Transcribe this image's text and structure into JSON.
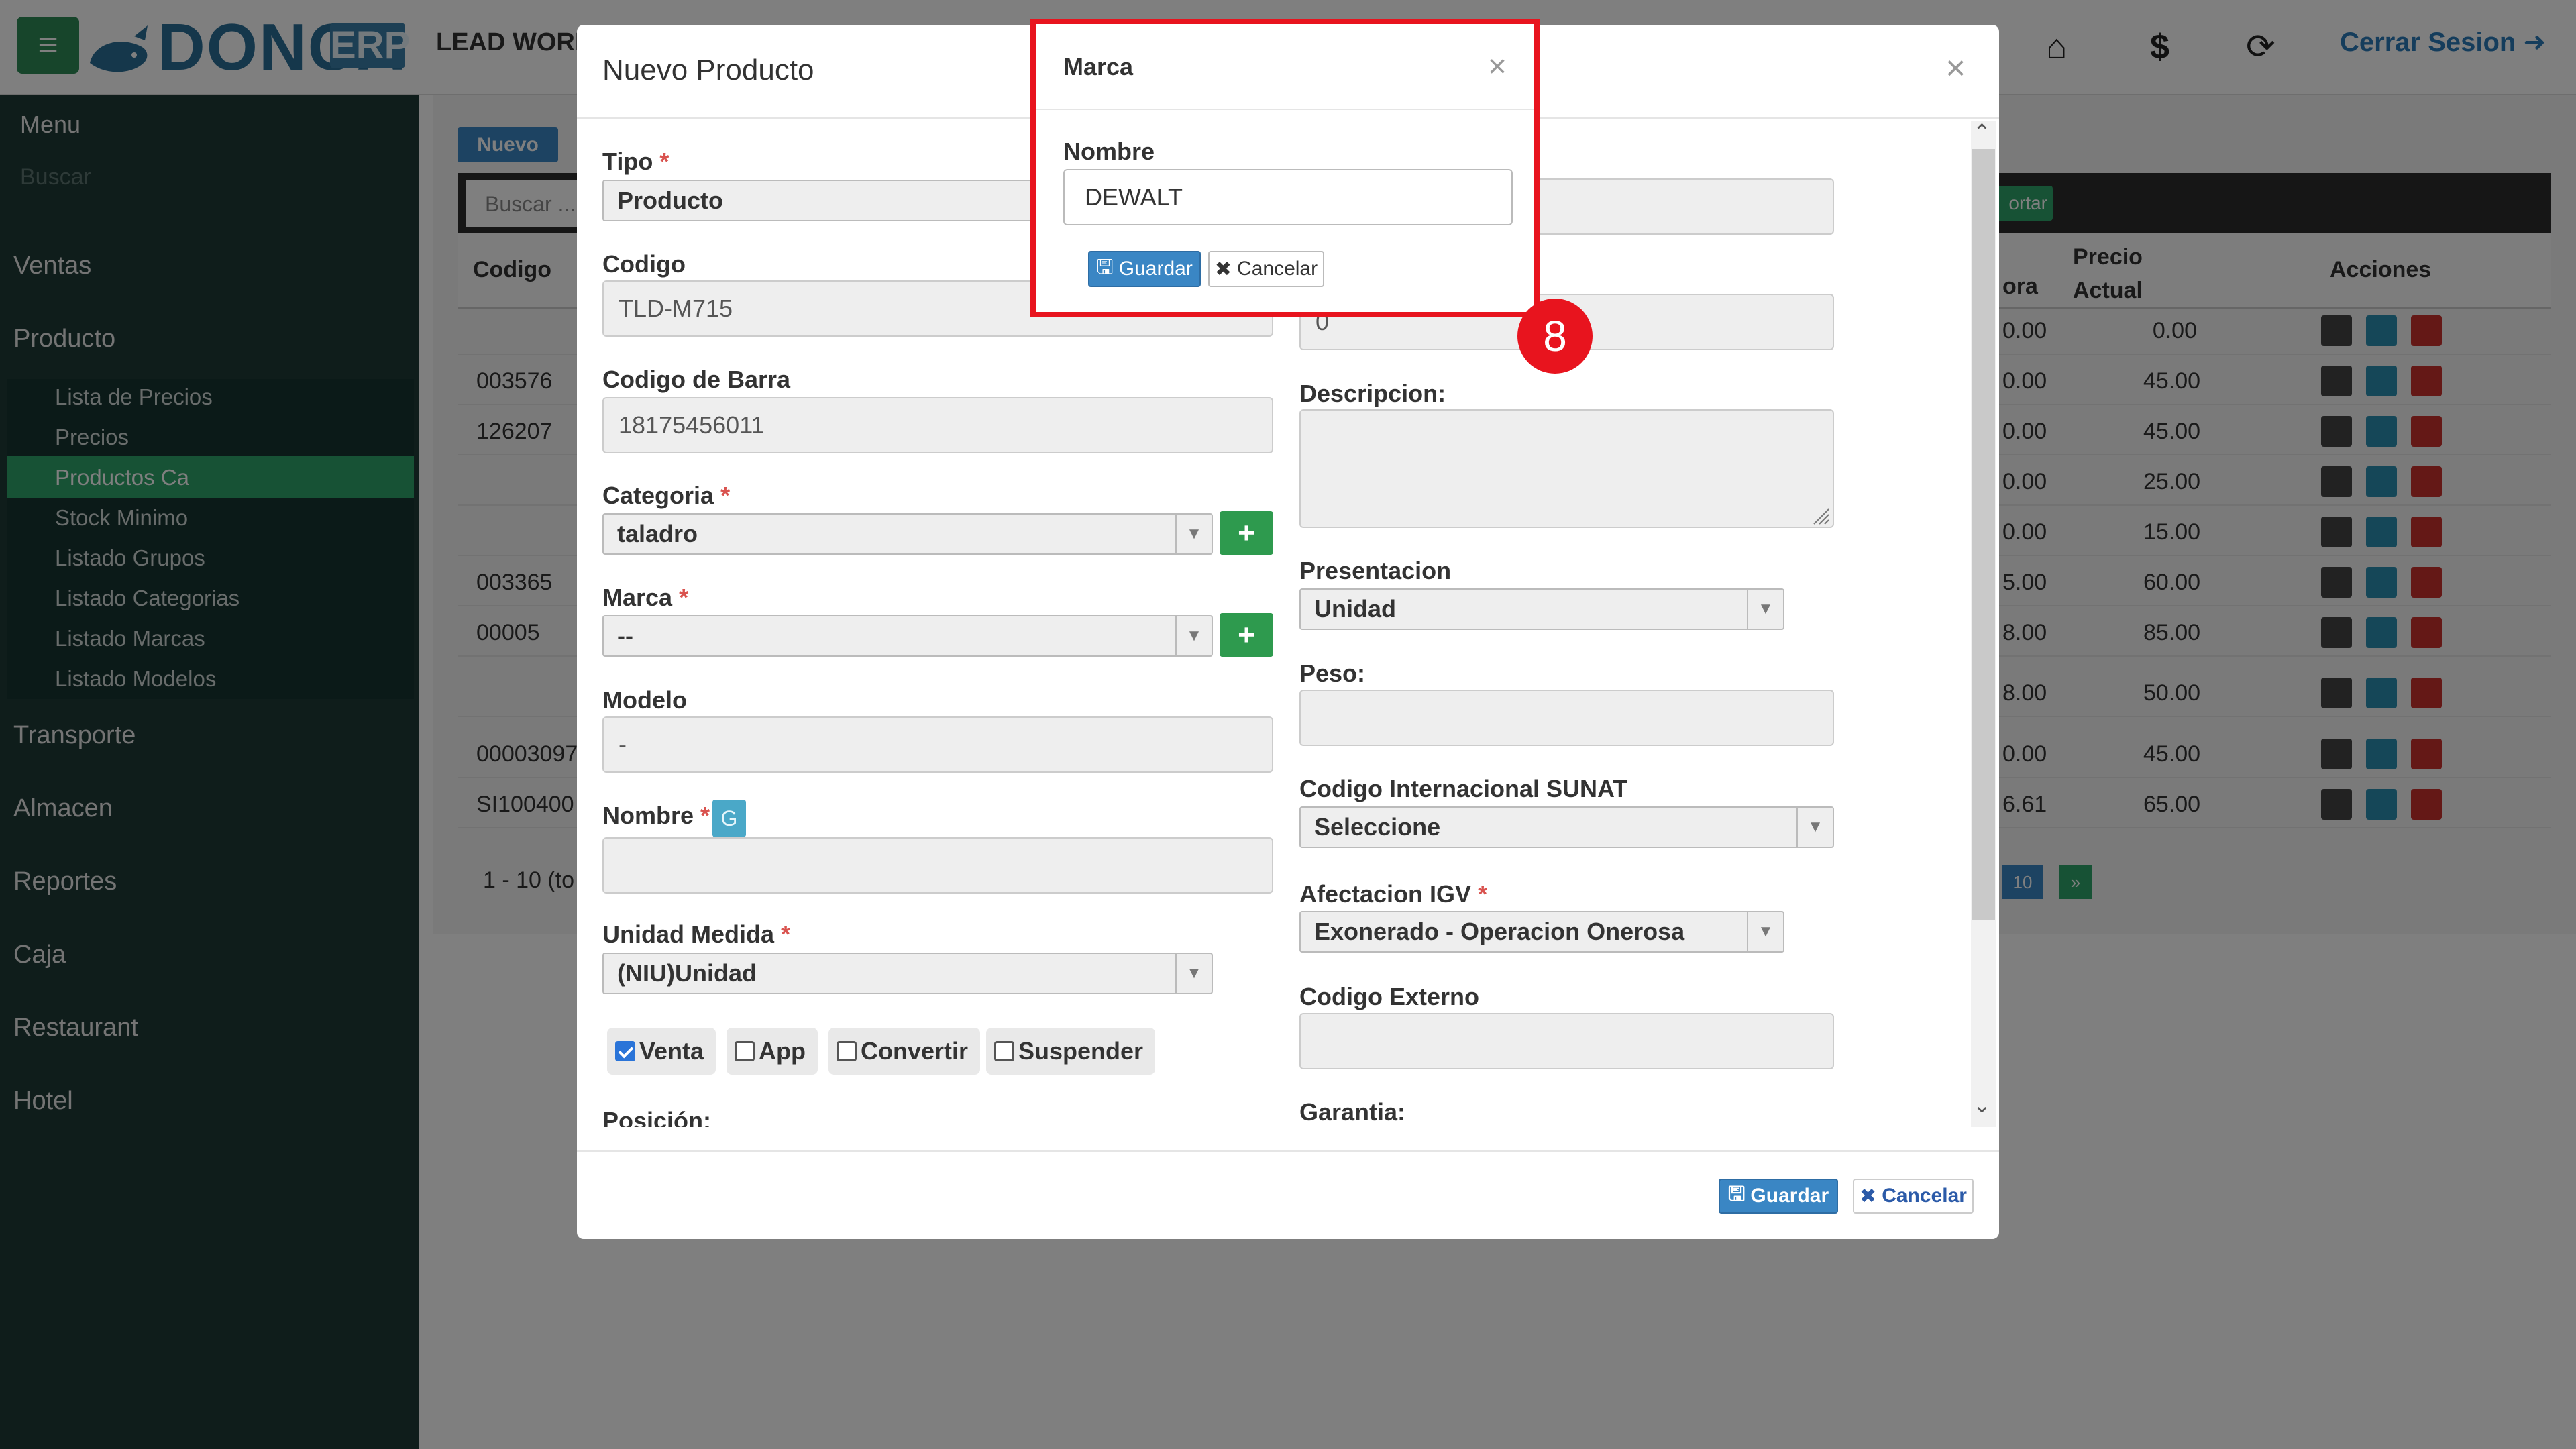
{
  "app": {
    "logo": "DONCA",
    "logo_suffix": "ERP",
    "company": "LEAD WORK",
    "logout": "Cerrar Sesion",
    "icons": [
      "home-icon",
      "dollar-icon",
      "refresh-lock-icon",
      "logout-icon"
    ]
  },
  "sidebar": {
    "menu_title": "Menu",
    "search_placeholder": "Buscar",
    "items": [
      "Ventas",
      "Producto",
      "Transporte",
      "Almacen",
      "Reportes",
      "Caja",
      "Restaurant",
      "Hotel"
    ],
    "product_subitems": [
      "Lista de Precios",
      "Precios",
      "Productos Ca",
      "Stock Minimo",
      "Listado Grupos",
      "Listado Categorias",
      "Listado Marcas",
      "Listado Modelos"
    ],
    "active_subitem": "Productos Ca"
  },
  "background_page": {
    "new_button": "Nuevo",
    "search_placeholder": "Buscar ...",
    "export_label": "ortar",
    "columns": [
      "Codigo",
      "ora",
      "Precio Actual",
      "Acciones"
    ],
    "rows": [
      {
        "code": "",
        "prev": "0.00",
        "price": "0.00"
      },
      {
        "code": "003576",
        "prev": "0.00",
        "price": "45.00"
      },
      {
        "code": "126207",
        "prev": "0.00",
        "price": "45.00"
      },
      {
        "code": "",
        "prev": "0.00",
        "price": "25.00"
      },
      {
        "code": "",
        "prev": "0.00",
        "price": "15.00"
      },
      {
        "code": "003365",
        "prev": "5.00",
        "price": "60.00"
      },
      {
        "code": "00005",
        "prev": "8.00",
        "price": "85.00"
      },
      {
        "code": "",
        "prev": "8.00",
        "price": "50.00"
      },
      {
        "code": "00003097",
        "prev": "0.00",
        "price": "45.00"
      },
      {
        "code": "SI100400",
        "prev": "6.61",
        "price": "65.00"
      }
    ],
    "range_text": "1 - 10 (to",
    "page_size": "10",
    "page_next": "»"
  },
  "modal": {
    "title": "Nuevo Producto",
    "close": "×",
    "fields": {
      "tipo_label": "Tipo",
      "tipo_value": "Producto",
      "codigo_label": "Codigo",
      "codigo_value": "TLD-M715",
      "codigo_barra_label": "Codigo de Barra",
      "codigo_barra_value": "18175456011",
      "categoria_label": "Categoria",
      "categoria_value": "taladro",
      "marca_label": "Marca",
      "marca_value": "--",
      "modelo_label": "Modelo",
      "modelo_value": "-",
      "nombre_label": "Nombre",
      "nombre_badge": "G",
      "nombre_value": "",
      "unidad_label": "Unidad Medida",
      "unidad_value": "(NIU)Unidad",
      "posicion_label": "Posición:",
      "right_top_value": "0",
      "descripcion_label": "Descripcion:",
      "presentacion_label": "Presentacion",
      "presentacion_value": "Unidad",
      "peso_label": "Peso:",
      "sunat_label": "Codigo Internacional SUNAT",
      "sunat_value": "Seleccione",
      "igv_label": "Afectacion IGV",
      "igv_value": "Exonerado - Operacion Onerosa",
      "externo_label": "Codigo Externo",
      "garantia_label": "Garantia:"
    },
    "checkboxes": [
      {
        "label": "Venta",
        "checked": true
      },
      {
        "label": "App",
        "checked": false
      },
      {
        "label": "Convertir",
        "checked": false
      },
      {
        "label": "Suspender",
        "checked": false
      }
    ],
    "save": "Guardar",
    "cancel": "Cancelar"
  },
  "marca_dialog": {
    "title": "Marca",
    "close": "×",
    "nombre_label": "Nombre",
    "nombre_value": "DEWALT",
    "save": "Guardar",
    "cancel": "Cancelar",
    "step_badge": "8"
  },
  "colors": {
    "highlight": "#e8141e",
    "primary": "#3a86c4",
    "success": "#2e9a4e",
    "sidebar": "#1f3b36"
  }
}
